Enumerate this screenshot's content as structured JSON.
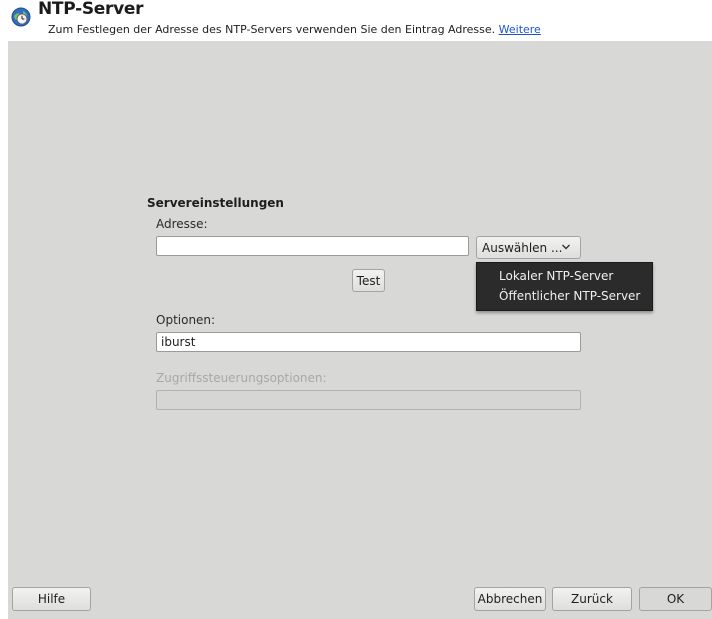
{
  "header": {
    "title": "NTP-Server",
    "subtitle": "Zum Festlegen der Adresse des NTP-Servers verwenden Sie den Eintrag Adresse.",
    "more_link": "Weitere"
  },
  "server_settings": {
    "section_title": "Servereinstellungen",
    "address_label": "Adresse:",
    "address_value": "",
    "select_button": "Auswählen ...",
    "test_button": "Test",
    "options_label": "Optionen:",
    "options_value": "iburst",
    "access_label": "Zugriffssteuerungsoptionen:",
    "access_value": ""
  },
  "select_menu": {
    "items": [
      "Lokaler NTP-Server",
      "Öffentlicher NTP-Server"
    ]
  },
  "footer": {
    "help": "Hilfe",
    "cancel": "Abbrechen",
    "back": "Zurück",
    "ok": "OK"
  },
  "icons": {
    "app": "ntp-clock-globe-icon",
    "dropdown": "chevron-down-icon"
  },
  "colors": {
    "panel_background": "#d8d8d6",
    "link": "#1d55c9",
    "popup_background": "#2b2b2b"
  }
}
